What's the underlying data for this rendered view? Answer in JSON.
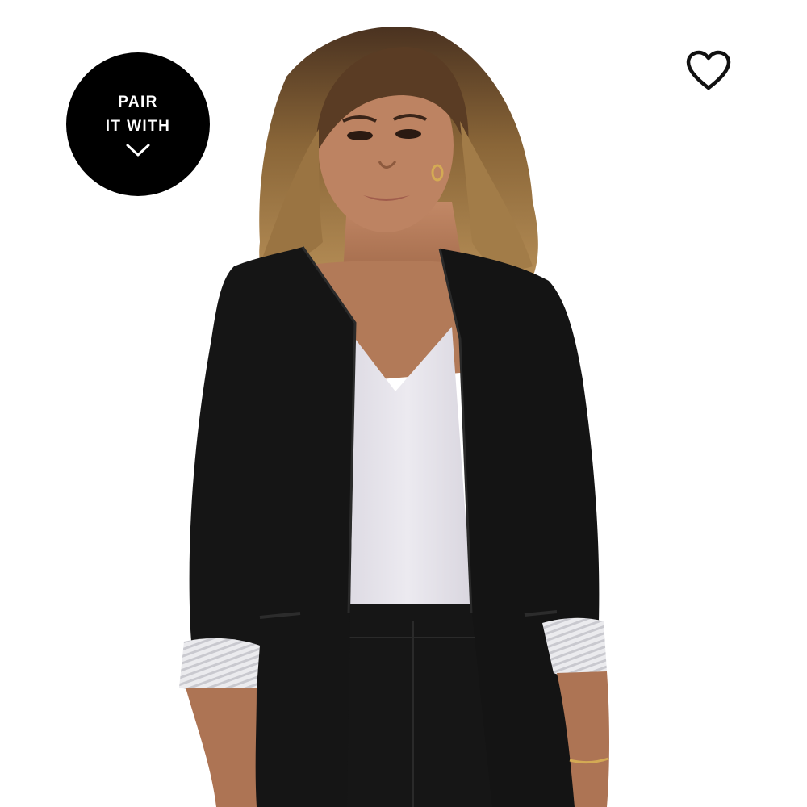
{
  "pair_badge": {
    "line1": "PAIR",
    "line2": "IT WITH",
    "icon": "chevron-down-icon"
  },
  "wishlist": {
    "icon": "heart-outline-icon"
  },
  "product_image": {
    "subject": "woman-wearing-black-open-front-blazer",
    "colors": {
      "blazer": "#141414",
      "camisole": "#e4e2ea",
      "cuff": "#e8e8ec",
      "skin": "#b57d5c",
      "hair": "#6a4a2c",
      "background": "#ffffff"
    }
  }
}
